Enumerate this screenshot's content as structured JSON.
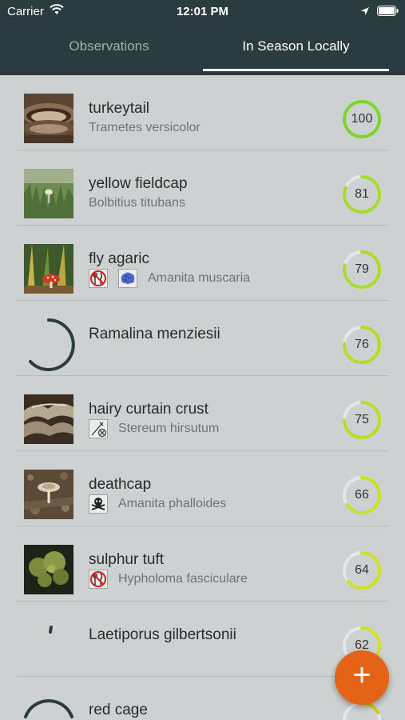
{
  "status_bar": {
    "carrier": "Carrier",
    "time": "12:01 PM"
  },
  "tabs": [
    {
      "label": "Observations",
      "selected": false
    },
    {
      "label": "In Season Locally",
      "selected": true
    }
  ],
  "species": [
    {
      "common": "turkeytail",
      "scientific": "Trametes versicolor",
      "score": "100",
      "badges": [],
      "thumbnail": "turkeytail-photo"
    },
    {
      "common": "yellow fieldcap",
      "scientific": "Bolbitius titubans",
      "score": "81",
      "badges": [],
      "thumbnail": "yellow-fieldcap-photo"
    },
    {
      "common": "fly agaric",
      "scientific": "Amanita muscaria",
      "score": "79",
      "badges": [
        "not-edible-icon",
        "psychoactive-brain-icon"
      ],
      "thumbnail": "fly-agaric-photo"
    },
    {
      "common": "Ramalina menziesii",
      "scientific": "",
      "score": "76",
      "badges": [],
      "thumbnail": "loading-spinner"
    },
    {
      "common": "hairy curtain crust",
      "scientific": "Stereum hirsutum",
      "score": "75",
      "badges": [
        "inedible-cutlery-icon"
      ],
      "thumbnail": "hairy-curtain-crust-photo"
    },
    {
      "common": "deathcap",
      "scientific": "Amanita phalloides",
      "score": "66",
      "badges": [
        "poison-skull-icon"
      ],
      "thumbnail": "deathcap-photo"
    },
    {
      "common": "sulphur tuft",
      "scientific": "Hypholoma fasciculare",
      "score": "64",
      "badges": [
        "not-edible-icon"
      ],
      "thumbnail": "sulphur-tuft-photo"
    },
    {
      "common": "Laetiporus gilbertsonii",
      "scientific": "",
      "score": "62",
      "badges": [],
      "thumbnail": "loading-spinner"
    },
    {
      "common": "red cage",
      "scientific": "",
      "score": "",
      "badges": [],
      "thumbnail": "loading-spinner"
    }
  ],
  "score_colors": {
    "100": "#7bd62a",
    "81": "#a4dc28",
    "79": "#a9dd27",
    "76": "#b0de26",
    "75": "#b4df25",
    "66": "#c9e023",
    "64": "#d0e022",
    "62": "#d6e021"
  },
  "fab": {
    "label": "+",
    "color": "#e46316",
    "icon": "add-icon"
  },
  "colors": {
    "header": "#2b3c40",
    "background": "#cdd1d1",
    "accent": "#e46316"
  }
}
